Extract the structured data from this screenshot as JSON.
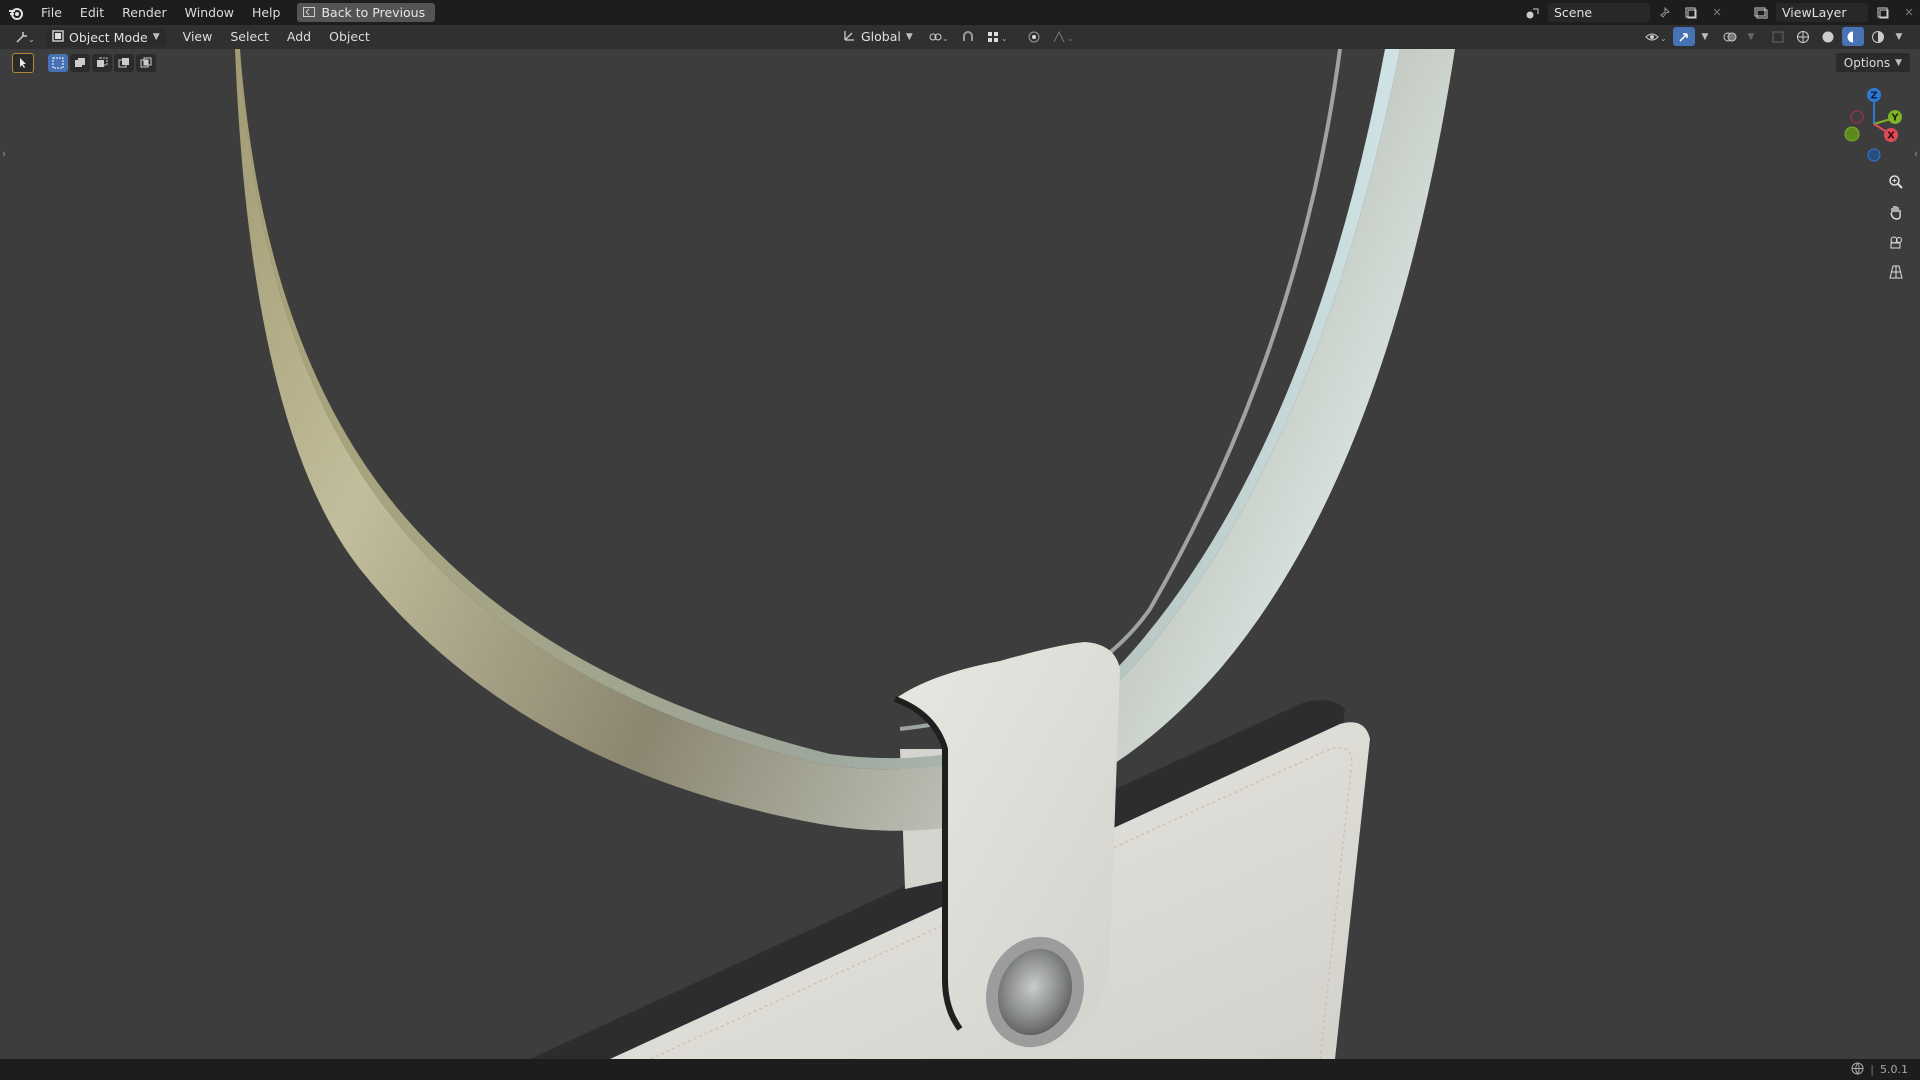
{
  "topbar": {
    "menus": [
      "File",
      "Edit",
      "Render",
      "Window",
      "Help"
    ],
    "back_button": "Back to Previous",
    "scene": "Scene",
    "view_layer": "ViewLayer"
  },
  "header": {
    "mode": "Object Mode",
    "menus": [
      "View",
      "Select",
      "Add",
      "Object"
    ],
    "transform_orientation": "Global",
    "options": "Options"
  },
  "gizmo": {
    "z": "Z",
    "y": "Y",
    "x": "X"
  },
  "status": {
    "version": "5.0.1"
  },
  "colors": {
    "accent": "#4772b3",
    "bg": "#3d3d3d",
    "ring_metal": "#b3b4a0",
    "leather": "#dfddd8"
  }
}
